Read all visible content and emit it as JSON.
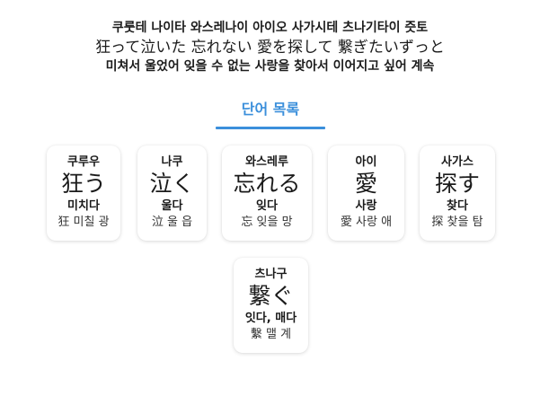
{
  "lyrics": {
    "pronunciation": "쿠룻테 나이타 와스레나이 아이오 사가시테 츠나기타이 즛토",
    "japanese": "狂って泣いた 忘れない 愛を探して 繋ぎたいずっと",
    "translation": "미쳐서 울었어 잊을 수 없는 사랑을 찾아서 이어지고 싶어 계속"
  },
  "section": {
    "title": "단어 목록"
  },
  "words": [
    {
      "reading": "쿠루우",
      "word": "狂う",
      "meaning": "미치다",
      "hanja": "狂 미칠 광"
    },
    {
      "reading": "나쿠",
      "word": "泣く",
      "meaning": "울다",
      "hanja": "泣 울 읍"
    },
    {
      "reading": "와스레루",
      "word": "忘れる",
      "meaning": "잊다",
      "hanja": "忘 잊을 망"
    },
    {
      "reading": "아이",
      "word": "愛",
      "meaning": "사랑",
      "hanja": "愛 사랑 애"
    },
    {
      "reading": "사가스",
      "word": "探す",
      "meaning": "찾다",
      "hanja": "探 찾을 탐"
    },
    {
      "reading": "츠나구",
      "word": "繋ぐ",
      "meaning": "잇다, 매다",
      "hanja": "繫 맬 계"
    }
  ]
}
